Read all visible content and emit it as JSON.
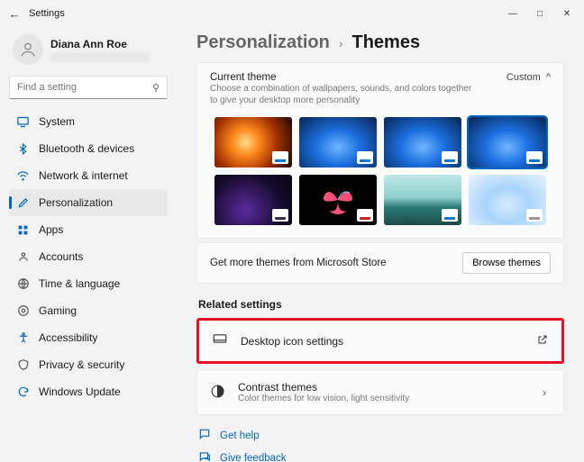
{
  "window": {
    "title": "Settings"
  },
  "user": {
    "name": "Diana Ann Roe"
  },
  "search": {
    "placeholder": "Find a setting"
  },
  "nav": {
    "items": [
      {
        "label": "System"
      },
      {
        "label": "Bluetooth & devices"
      },
      {
        "label": "Network & internet"
      },
      {
        "label": "Personalization"
      },
      {
        "label": "Apps"
      },
      {
        "label": "Accounts"
      },
      {
        "label": "Time & language"
      },
      {
        "label": "Gaming"
      },
      {
        "label": "Accessibility"
      },
      {
        "label": "Privacy & security"
      },
      {
        "label": "Windows Update"
      }
    ]
  },
  "breadcrumb": {
    "parent": "Personalization",
    "current": "Themes"
  },
  "current_theme": {
    "title": "Current theme",
    "subtitle": "Choose a combination of wallpapers, sounds, and colors together to give your desktop more personality",
    "mode": "Custom"
  },
  "store": {
    "text": "Get more themes from Microsoft Store",
    "button": "Browse themes"
  },
  "related": {
    "heading": "Related settings",
    "desktop_icons": "Desktop icon settings",
    "contrast_title": "Contrast themes",
    "contrast_sub": "Color themes for low vision, light sensitivity"
  },
  "help": {
    "get_help": "Get help",
    "feedback": "Give feedback"
  }
}
